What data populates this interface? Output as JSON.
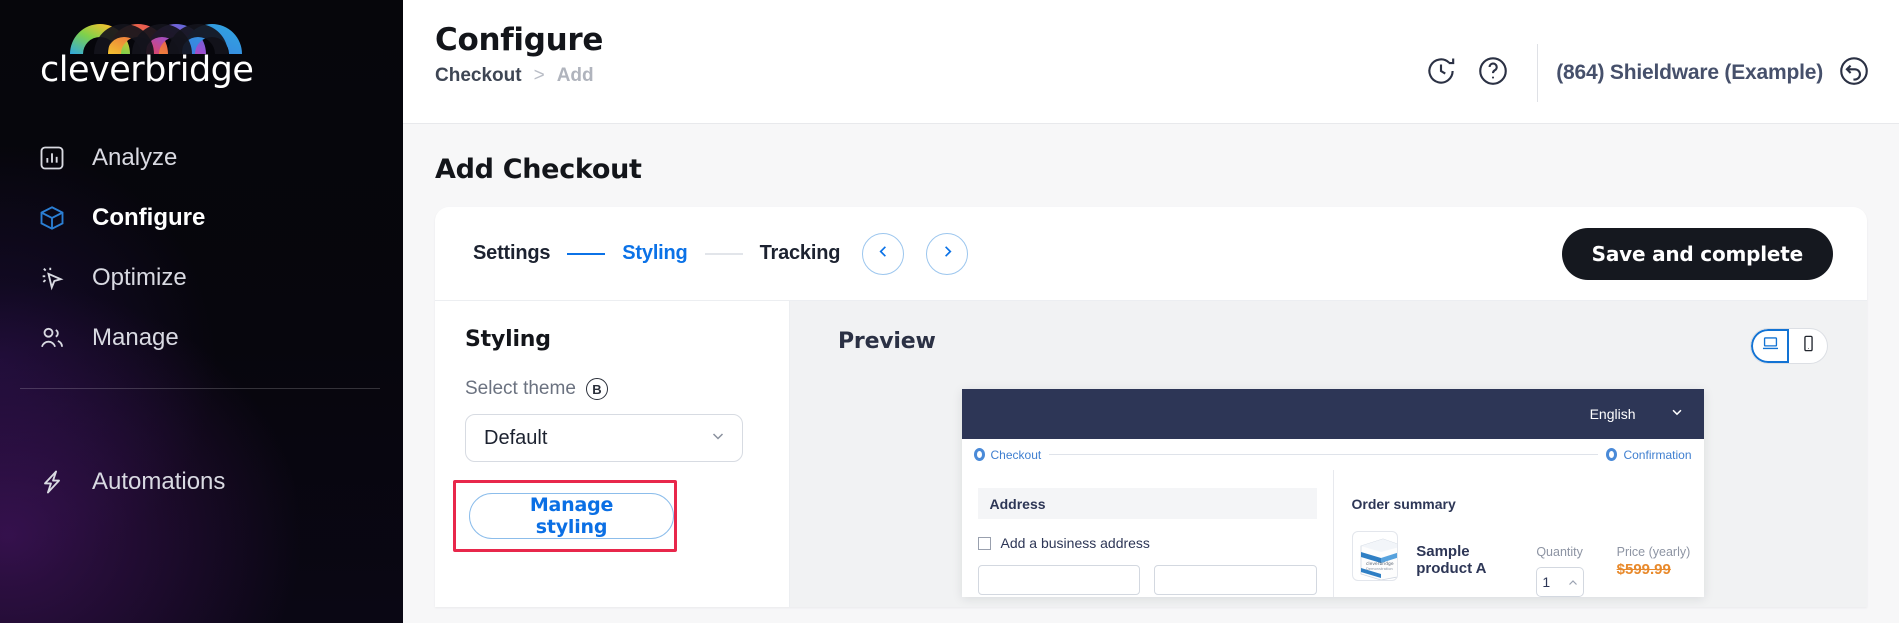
{
  "brand": {
    "logo_word": "cleverbridge",
    "logo_icon": "rainbow-arches-logo",
    "accent_blue": "#0b72e7",
    "dark": "#15181f",
    "highlight_red": "#e8274b"
  },
  "sidebar": {
    "items": [
      {
        "label": "Analyze",
        "icon": "bar-chart-icon",
        "active": false
      },
      {
        "label": "Configure",
        "icon": "cube-icon",
        "active": true
      },
      {
        "label": "Optimize",
        "icon": "cursor-click-icon",
        "active": false
      },
      {
        "label": "Manage",
        "icon": "users-icon",
        "active": false
      }
    ],
    "lower_items": [
      {
        "label": "Automations",
        "icon": "lightning-bolt-icon",
        "active": false
      }
    ]
  },
  "header": {
    "title": "Configure",
    "breadcrumb": {
      "parent": "Checkout",
      "separator": ">",
      "current": "Add"
    },
    "history_icon": "clock-rotate-icon",
    "help_icon": "question-circle-icon",
    "account_name": "(864) Shieldware (Example)",
    "account_switch_icon": "undo-arrow-circle-icon"
  },
  "main": {
    "section_title": "Add Checkout",
    "stepper": {
      "steps": [
        {
          "label": "Settings",
          "active": false
        },
        {
          "label": "Styling",
          "active": true
        },
        {
          "label": "Tracking",
          "active": false
        }
      ],
      "prev_icon": "chevron-left-icon",
      "next_icon": "chevron-right-icon"
    },
    "save_label": "Save and complete"
  },
  "styling_pane": {
    "title": "Styling",
    "theme_field_label": "Select theme",
    "theme_badge": "B",
    "theme_value": "Default",
    "theme_options": [
      "Default"
    ],
    "dropdown_icon": "chevron-down-icon",
    "manage_styling_label": "Manage styling",
    "highlight_annotation": "red-highlight-box"
  },
  "preview": {
    "title": "Preview",
    "devices": [
      {
        "name": "desktop",
        "icon": "laptop-icon",
        "selected": true
      },
      {
        "name": "mobile",
        "icon": "mobile-phone-icon",
        "selected": false
      }
    ],
    "checkout": {
      "language": "English",
      "language_icon": "chevron-down-icon",
      "steps": [
        {
          "label": "Checkout",
          "state": "current"
        },
        {
          "label": "Confirmation",
          "state": "upcoming"
        }
      ],
      "address": {
        "section_title": "Address",
        "business_checkbox_label": "Add a business address",
        "business_checkbox_checked": false,
        "fields": [
          "",
          ""
        ]
      },
      "order_summary": {
        "section_title": "Order summary",
        "columns": {
          "quantity": "Quantity",
          "price": "Price (yearly)"
        },
        "items": [
          {
            "name": "Sample product A",
            "thumb_icon": "product-box-image",
            "thumb_caption": "cleverbridge Demonstration",
            "quantity": "1",
            "price": "$599.99",
            "price_struck": true,
            "price_color": "#e8892b"
          }
        ]
      }
    }
  }
}
